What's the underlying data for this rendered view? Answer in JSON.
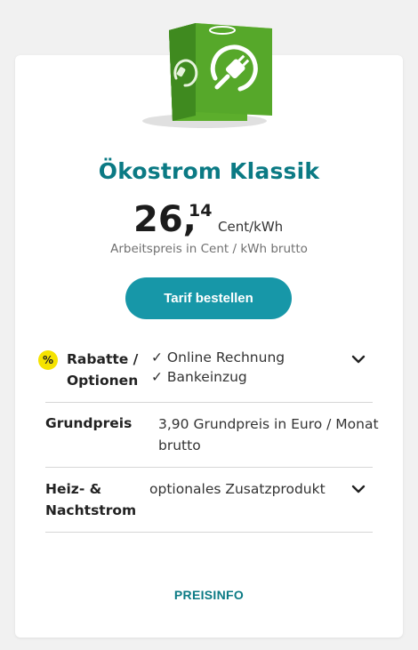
{
  "product": {
    "title": "Ökostrom Klassik",
    "price_integer": "26,",
    "price_decimals": "14",
    "price_unit": "Cent/kWh",
    "price_description": "Arbeitspreis in Cent / kWh brutto",
    "order_button": "Tarif bestellen"
  },
  "rows": {
    "rabatte": {
      "badge": "%",
      "label_line1": "Rabatte /",
      "label_line2": "Optionen",
      "option1": "✓ Online Rechnung",
      "option2": "✓ Bankeinzug",
      "icon": "chevron-down-icon"
    },
    "grundpreis": {
      "label": "Grundpreis",
      "value_line1": "3,90 Grundpreis in Euro / Monat",
      "value_line2": "brutto"
    },
    "heizstrom": {
      "label_line1": "Heiz- &",
      "label_line2": "Nachtstrom",
      "value": "optionales Zusatzprodukt",
      "icon": "chevron-down-icon"
    }
  },
  "footer": {
    "link": "PREISINFO"
  },
  "colors": {
    "accent": "#0b7a84",
    "button": "#1797a8",
    "badge": "#f5e300",
    "cube_green": "#5cae2c"
  }
}
